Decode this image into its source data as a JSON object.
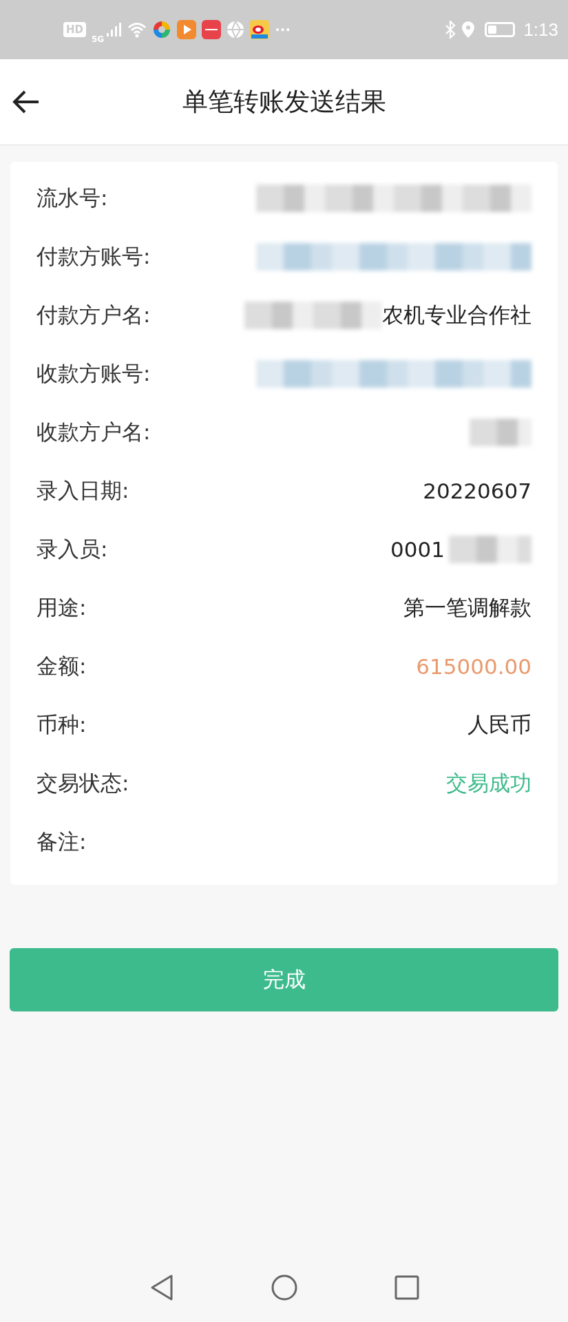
{
  "status_bar": {
    "network_badge": "HD",
    "network_type": "5G",
    "more": "···",
    "time": "1:13"
  },
  "header": {
    "title": "单笔转账发送结果"
  },
  "rows": [
    {
      "label": "流水号:",
      "redaction": {
        "kind": "gray"
      }
    },
    {
      "label": "付款方账号:",
      "redaction": {
        "kind": "blue"
      }
    },
    {
      "label": "付款方户名:",
      "redaction": {
        "kind": "mid"
      },
      "value": "农机专业合作社",
      "kind": "normal"
    },
    {
      "label": "收款方账号:",
      "redaction": {
        "kind": "blue"
      }
    },
    {
      "label": "收款方户名:",
      "redaction": {
        "kind": "short"
      }
    },
    {
      "label": "录入日期:",
      "value": "20220607",
      "kind": "normal"
    },
    {
      "label": "录入员:",
      "value": "0001",
      "kind": "normal",
      "redaction_after": {
        "kind": "tiny"
      }
    },
    {
      "label": "用途:",
      "value": "第一笔调解款",
      "kind": "normal"
    },
    {
      "label": "金额:",
      "value": "615000.00",
      "kind": "amount"
    },
    {
      "label": "币种:",
      "value": "人民币",
      "kind": "normal"
    },
    {
      "label": "交易状态:",
      "value": "交易成功",
      "kind": "success"
    },
    {
      "label": "备注:"
    }
  ],
  "done_button": {
    "label": "完成"
  }
}
